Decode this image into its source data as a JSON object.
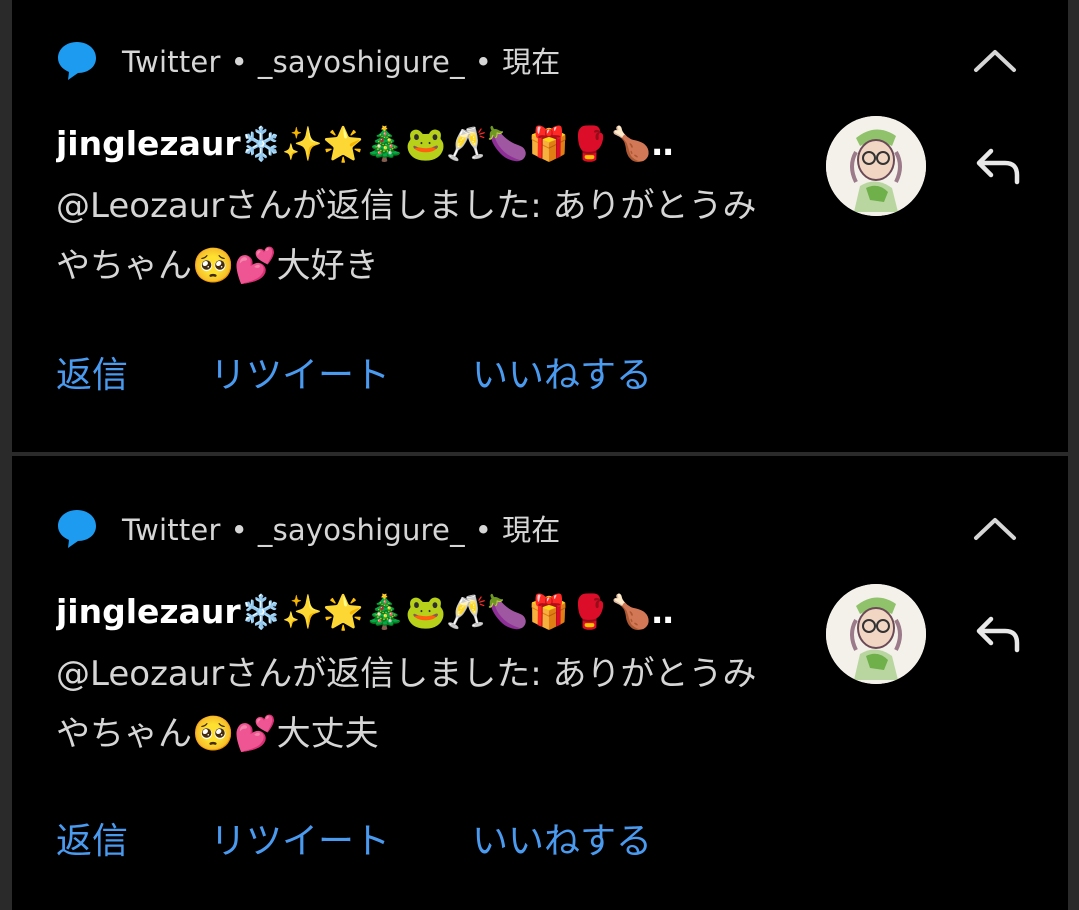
{
  "notifications": [
    {
      "header": {
        "app": "Twitter",
        "account": "_sayoshigure_",
        "time": "現在",
        "separator": "•"
      },
      "title": "jinglezaur❄️✨🌟🎄🐸🥂🍆🎁🥊🍗‥",
      "body": "@Leozaurさんが返信しました: ありがとうみやちゃん🥺💕大好き",
      "actions": {
        "reply": "返信",
        "retweet": "リツイート",
        "like": "いいねする"
      }
    },
    {
      "header": {
        "app": "Twitter",
        "account": "_sayoshigure_",
        "time": "現在",
        "separator": "•"
      },
      "title": "jinglezaur❄️✨🌟🎄🐸🥂🍆🎁🥊🍗‥",
      "body": "@Leozaurさんが返信しました: ありがとうみやちゃん🥺💕大丈夫",
      "actions": {
        "reply": "返信",
        "retweet": "リツイート",
        "like": "いいねする"
      }
    }
  ],
  "colors": {
    "accent": "#4a9bf0",
    "twitter_icon": "#1d9bf0",
    "background": "#000000"
  },
  "icons": [
    "speech-bubble-icon",
    "chevron-up-icon",
    "reply-arrow-icon"
  ]
}
